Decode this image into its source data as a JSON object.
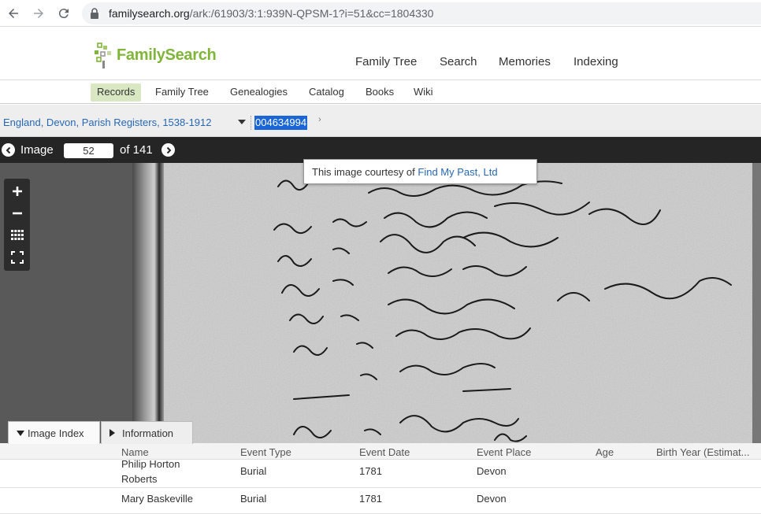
{
  "browser": {
    "url_host": "familysearch.org",
    "url_path": "/ark:/61903/3:1:939N-QPSM-1?i=51&cc=1804330"
  },
  "header": {
    "logo_text": "FamilySearch",
    "nav": [
      "Family Tree",
      "Search",
      "Memories",
      "Indexing"
    ]
  },
  "subnav": {
    "items": [
      "Records",
      "Family Tree",
      "Genealogies",
      "Catalog",
      "Books",
      "Wiki"
    ],
    "active": "Records"
  },
  "breadcrumb": {
    "collection": "England, Devon, Parish Registers, 1538-1912",
    "film_number": "004634994",
    "chevron": "›"
  },
  "viewer": {
    "image_label": "Image",
    "image_number": "52",
    "of_label": "of 141",
    "tooltip_prefix": "This image courtesy of",
    "tooltip_link": "Find My Past, Ltd"
  },
  "tabs": {
    "image_index": "Image Index",
    "information": "Information"
  },
  "table": {
    "columns": [
      "Name",
      "Event Type",
      "Event Date",
      "Event Place",
      "Age",
      "Birth Year (Estimat..."
    ],
    "rows": [
      {
        "name": "Philip Horton Roberts",
        "event_type": "Burial",
        "event_date": "1781",
        "event_place": "Devon"
      },
      {
        "name": "Mary Baskeville",
        "event_type": "Burial",
        "event_date": "1781",
        "event_place": "Devon"
      }
    ]
  },
  "icons": {
    "back": "arrow-left-icon",
    "forward": "arrow-right-icon",
    "reload": "reload-icon",
    "lock": "lock-icon",
    "zoom_in": "plus-icon",
    "zoom_out": "minus-icon",
    "grid": "grid-icon",
    "fullscreen": "fullscreen-icon"
  },
  "colors": {
    "brand_green": "#7fb539",
    "link_blue": "#2668b4",
    "active_tab_bg": "#d9e8c3"
  }
}
